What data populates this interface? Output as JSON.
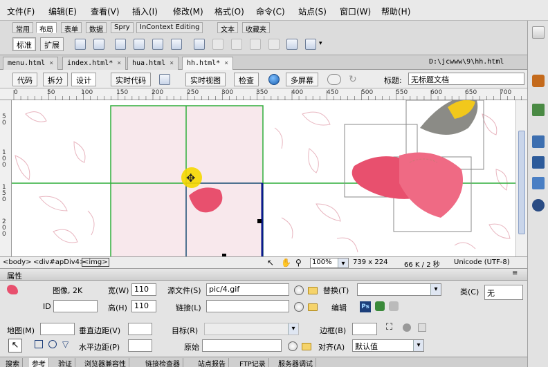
{
  "menubar": {
    "items": [
      "文件(F)",
      "编辑(E)",
      "查看(V)",
      "插入(I)",
      "修改(M)",
      "格式(O)",
      "命令(C)",
      "站点(S)",
      "窗口(W)",
      "帮助(H)"
    ]
  },
  "insert_bar": {
    "tabs": [
      "常用",
      "布局",
      "表单",
      "数据",
      "Spry",
      "InContext Editing",
      "文本",
      "收藏夹"
    ],
    "active_tab": "布局",
    "mode_buttons": [
      "标准",
      "扩展"
    ]
  },
  "doc_tabs": {
    "tabs": [
      "menu.html",
      "index.html*",
      "hua.html",
      "hh.html*"
    ],
    "active": "hh.html*",
    "path": "D:\\jcwww\\9\\hh.html"
  },
  "doc_toolbar": {
    "code": "代码",
    "split": "拆分",
    "design": "设计",
    "live_code": "实时代码",
    "live_view": "实时视图",
    "inspect": "检查",
    "multiscreen": "多屏幕",
    "title_label": "标题:",
    "title_value": "无标题文档"
  },
  "ruler": {
    "h_labels": [
      "0",
      "50",
      "100",
      "150",
      "200",
      "250",
      "300",
      "350",
      "400",
      "450",
      "500",
      "550",
      "600",
      "650",
      "700"
    ],
    "v_labels": [
      "5\n0",
      "1\n0\n0",
      "1\n5\n0",
      "2\n0\n0"
    ]
  },
  "status_bar": {
    "tag_body": "<body>",
    "tag_div": "<div#apDiv4>",
    "tag_img": "<img>",
    "zoom": "100%",
    "dimensions": "739 x 224",
    "size_time": "66 K / 2 秒",
    "encoding": "Unicode (UTF-8)"
  },
  "properties": {
    "header": "属性",
    "image_label": "图像, 2K",
    "id_label": "ID",
    "width_label": "宽(W)",
    "width_value": "110",
    "height_label": "高(H)",
    "height_value": "110",
    "src_label": "源文件(S)",
    "src_value": "pic/4.gif",
    "link_label": "链接(L)",
    "alt_label": "替换(T)",
    "edit_label": "编辑",
    "class_label": "类(C)",
    "class_value": "无",
    "map_label": "地图(M)",
    "vspace_label": "垂直边距(V)",
    "hspace_label": "水平边距(P)",
    "target_label": "目标(R)",
    "original_label": "原始",
    "border_label": "边框(B)",
    "align_label": "对齐(A)",
    "align_value": "默认值"
  },
  "bottom_tabs": [
    "搜索",
    "参考",
    "验证",
    "浏览器兼容性",
    "链接检查器",
    "站点报告",
    "FTP记录",
    "服务器调试"
  ],
  "bottom_active": "参考",
  "colors": {
    "guide_green": "#2eae3a",
    "selection_blue": "#0b1a8c",
    "petal_pink": "#e8506e",
    "highlight_yellow": "#f5d800"
  },
  "icons": [
    "image-icon",
    "globe-icon",
    "refresh-icon",
    "ps-icon",
    "pointer-icon",
    "hand-icon",
    "zoom-icon"
  ]
}
